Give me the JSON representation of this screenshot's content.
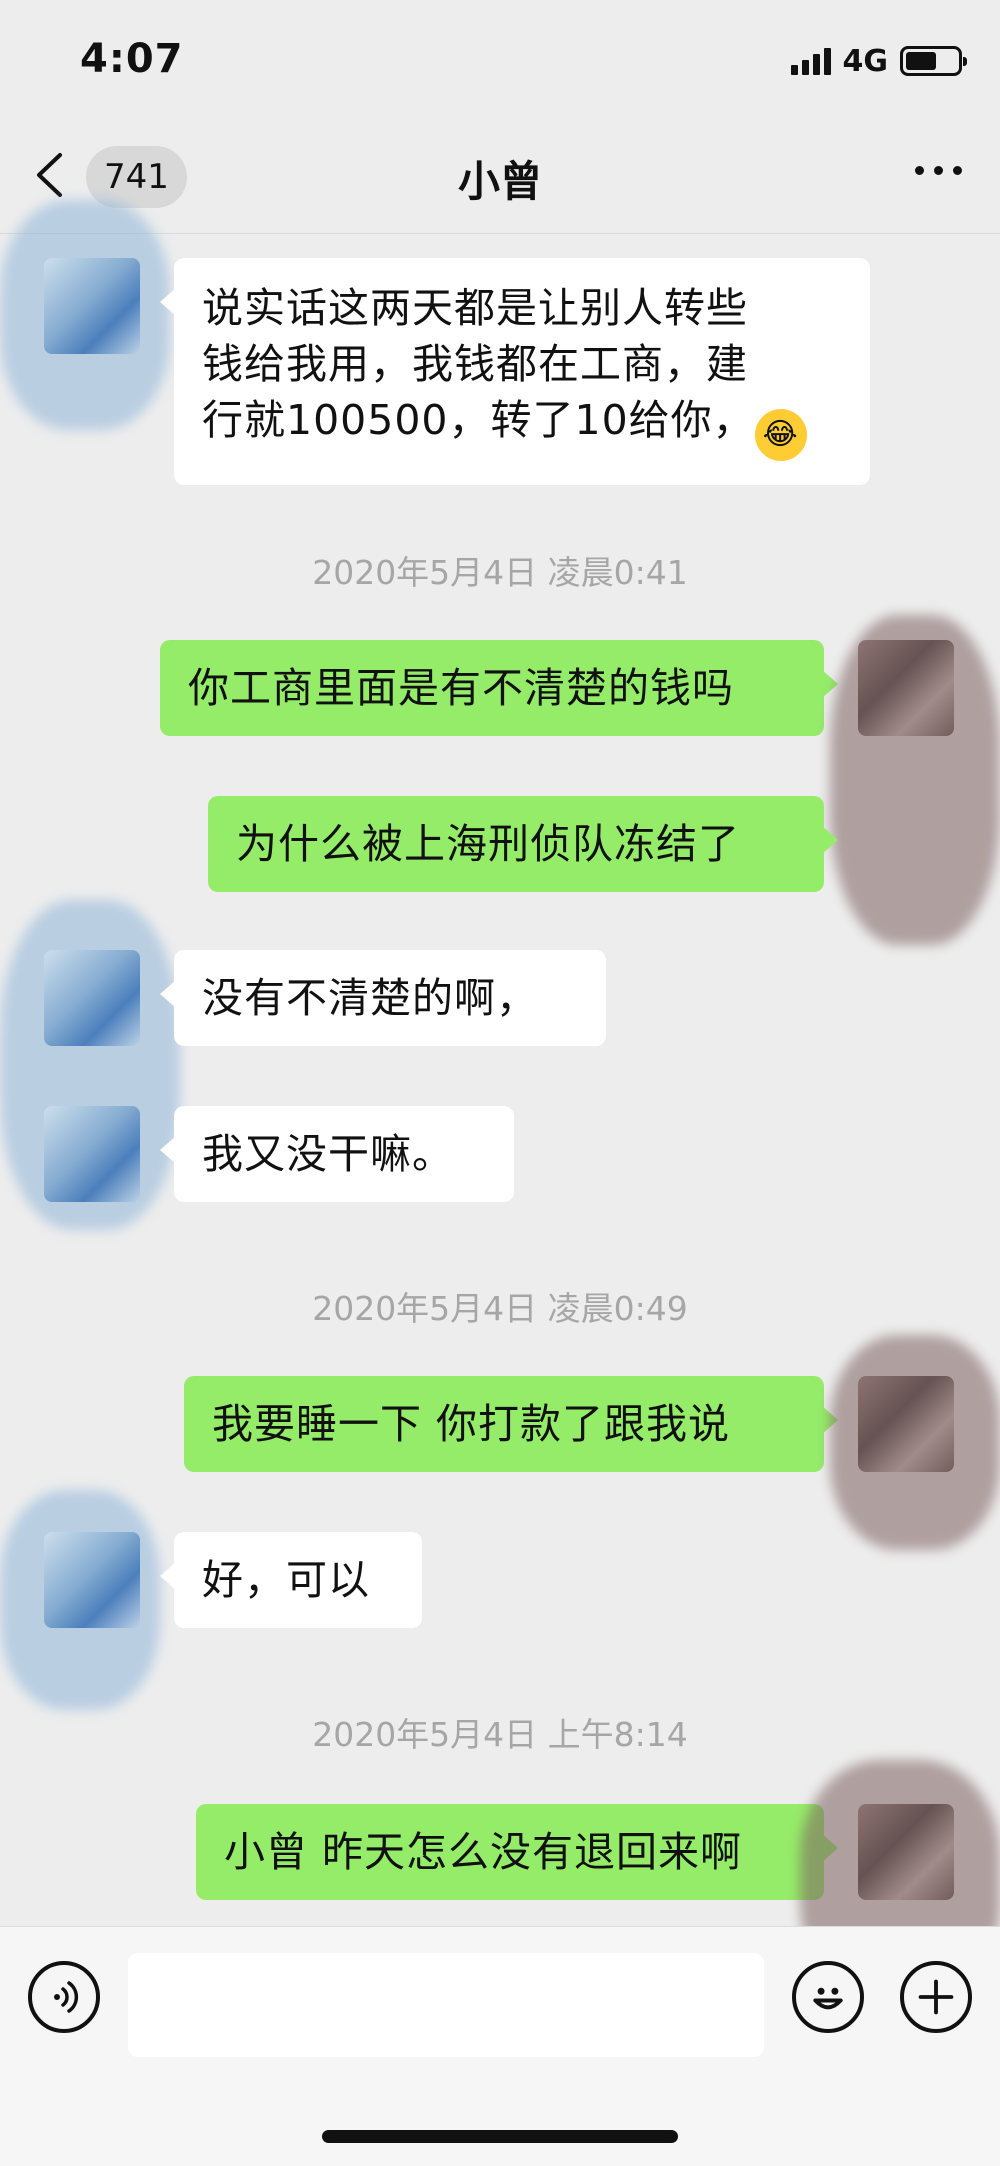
{
  "status_bar": {
    "time": "4:07",
    "network": "4G",
    "battery_level": 0.6
  },
  "nav": {
    "unread_count": "741",
    "title": "小曾",
    "back_icon": "chevron-left-icon",
    "more_icon": "ellipsis-icon"
  },
  "messages": [
    {
      "type": "in",
      "lines": [
        "说实话这两天都是让别人转些",
        "钱给我用，我钱都在工商，建",
        "行就100500，转了10给你，"
      ],
      "emoji": "😂"
    },
    {
      "type": "time",
      "text": "2020年5月4日 凌晨0:41"
    },
    {
      "type": "out",
      "text": "你工商里面是有不清楚的钱吗"
    },
    {
      "type": "out",
      "text": "为什么被上海刑侦队冻结了"
    },
    {
      "type": "in",
      "text": "没有不清楚的啊，"
    },
    {
      "type": "in",
      "text": "我又没干嘛。"
    },
    {
      "type": "time",
      "text": "2020年5月4日 凌晨0:49"
    },
    {
      "type": "out",
      "text": "我要睡一下 你打款了跟我说"
    },
    {
      "type": "in",
      "text": "好，可以"
    },
    {
      "type": "time",
      "text": "2020年5月4日 上午8:14"
    },
    {
      "type": "out",
      "text": "小曾 昨天怎么没有退回来啊"
    }
  ],
  "input_bar": {
    "message_value": "",
    "voice_icon": "voice-icon",
    "emoji_icon": "emoji-icon",
    "plus_icon": "plus-icon"
  },
  "colors": {
    "background": "#ededed",
    "outgoing_bubble": "#95ec69",
    "incoming_bubble": "#ffffff",
    "timestamp_text": "#a6a6a6"
  }
}
